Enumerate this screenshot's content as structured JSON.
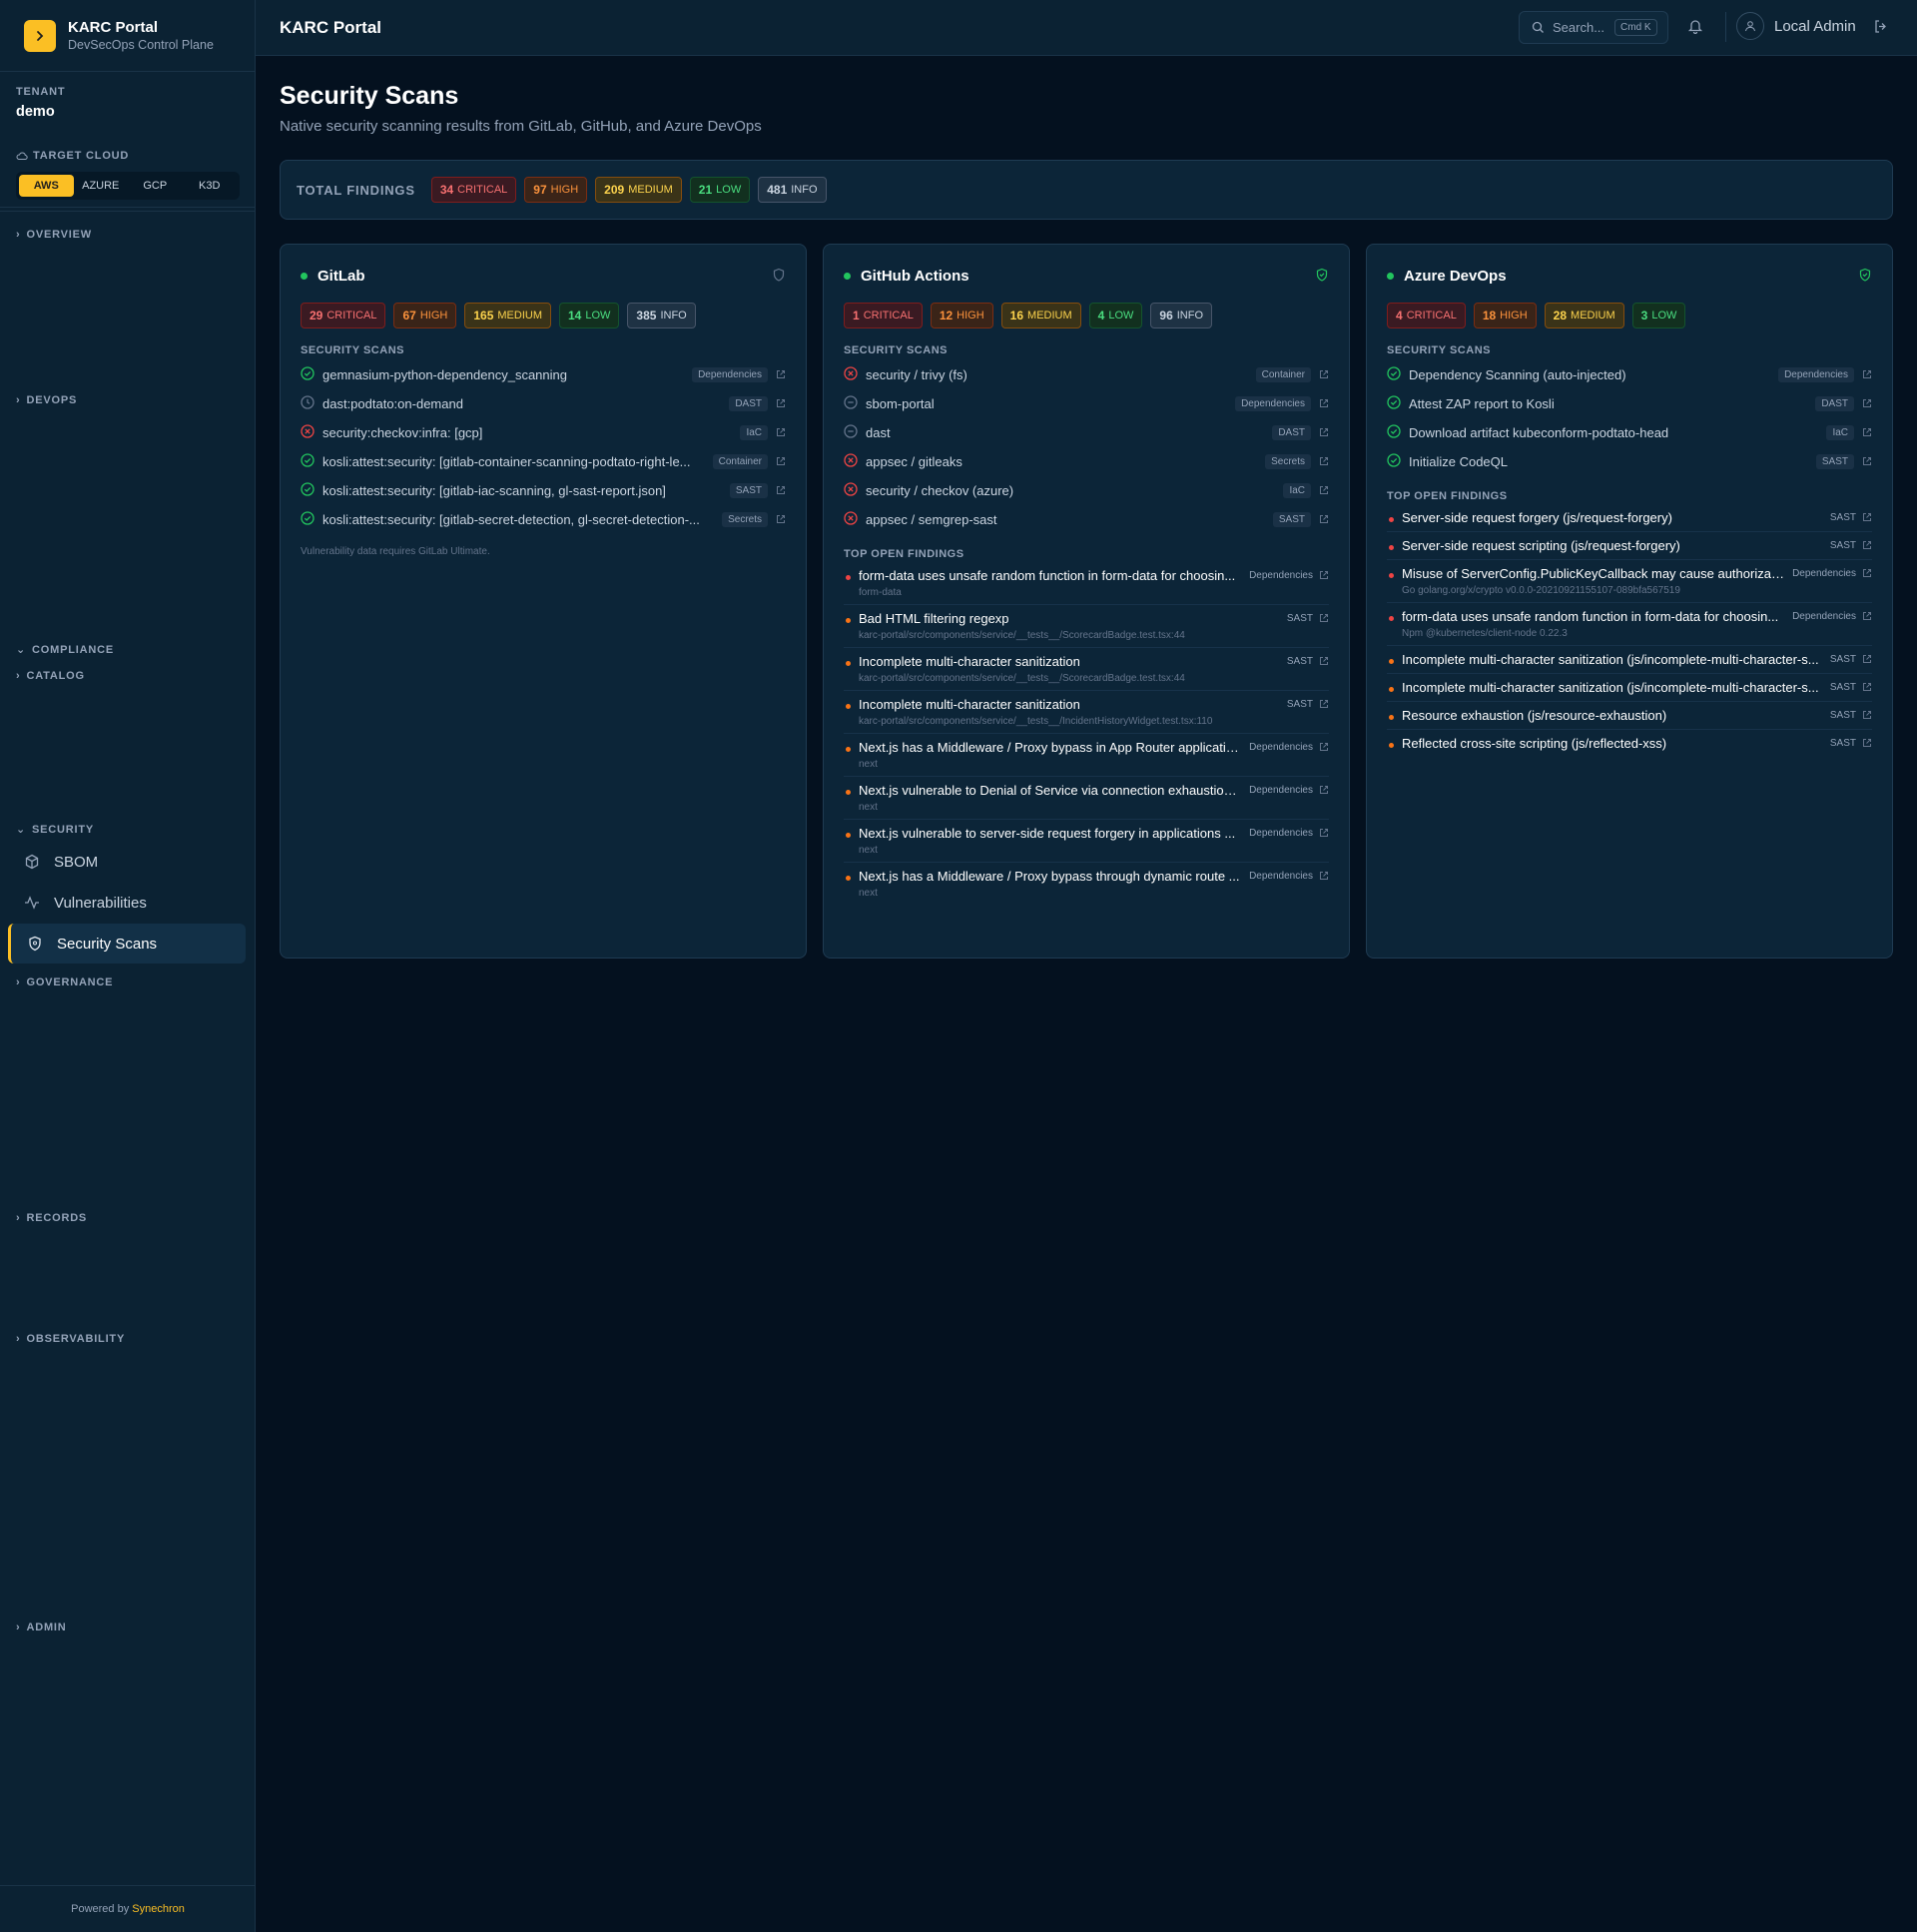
{
  "app": {
    "title": "KARC Portal",
    "subtitle": "DevSecOps Control Plane",
    "powered_prefix": "Powered by",
    "powered_brand": "Synechron"
  },
  "tenant": {
    "label": "TENANT",
    "value": "demo"
  },
  "target_cloud": {
    "label": "TARGET CLOUD",
    "options": [
      "AWS",
      "AZURE",
      "GCP",
      "K3D"
    ],
    "selected": "AWS"
  },
  "nav": {
    "overview": "OVERVIEW",
    "devops": "DEVOPS",
    "compliance": "COMPLIANCE",
    "catalog": "CATALOG",
    "security": "SECURITY",
    "sbom": "SBOM",
    "vulnerabilities": "Vulnerabilities",
    "security_scans": "Security Scans",
    "governance": "GOVERNANCE",
    "records": "RECORDS",
    "observability": "OBSERVABILITY",
    "admin": "ADMIN"
  },
  "header": {
    "title": "KARC Portal",
    "search_placeholder": "Search...",
    "shortcut": "Cmd K",
    "user": "Local Admin"
  },
  "page": {
    "title": "Security Scans",
    "subtitle": "Native security scanning results from GitLab, GitHub, and Azure DevOps",
    "totals_label": "TOTAL FINDINGS",
    "totals": {
      "critical": "34",
      "high": "97",
      "medium": "209",
      "low": "21",
      "info": "481"
    }
  },
  "labels": {
    "critical": "CRITICAL",
    "high": "HIGH",
    "medium": "MEDIUM",
    "low": "LOW",
    "info": "INFO",
    "security_scans": "SECURITY SCANS",
    "top_open_findings": "TOP OPEN FINDINGS"
  },
  "colors": {
    "accent": "#fbbf24",
    "critical": "#ef4444",
    "high": "#f97316",
    "medium": "#facc15",
    "low": "#22c55e",
    "info": "#94a3b8"
  },
  "providers": [
    {
      "name": "GitLab",
      "counts": {
        "critical": "29",
        "high": "67",
        "medium": "165",
        "low": "14",
        "info": "385"
      },
      "scans": [
        {
          "status": "pass",
          "name": "gemnasium-python-dependency_scanning",
          "type": "Dependencies"
        },
        {
          "status": "pending",
          "name": "dast:podtato:on-demand",
          "type": "DAST"
        },
        {
          "status": "fail",
          "name": "security:checkov:infra: [gcp]",
          "type": "IaC"
        },
        {
          "status": "pass",
          "name": "kosli:attest:security: [gitlab-container-scanning-podtato-right-le...",
          "type": "Container"
        },
        {
          "status": "pass",
          "name": "kosli:attest:security: [gitlab-iac-scanning, gl-sast-report.json]",
          "type": "SAST"
        },
        {
          "status": "pass",
          "name": "kosli:attest:security: [gitlab-secret-detection, gl-secret-detection-...",
          "type": "Secrets"
        }
      ],
      "note": "Vulnerability data requires GitLab Ultimate.",
      "findings": []
    },
    {
      "name": "GitHub Actions",
      "counts": {
        "critical": "1",
        "high": "12",
        "medium": "16",
        "low": "4",
        "info": "96"
      },
      "scans": [
        {
          "status": "fail",
          "name": "security / trivy (fs)",
          "type": "Container"
        },
        {
          "status": "skip",
          "name": "sbom-portal",
          "type": "Dependencies"
        },
        {
          "status": "skip",
          "name": "dast",
          "type": "DAST"
        },
        {
          "status": "fail",
          "name": "appsec / gitleaks",
          "type": "Secrets"
        },
        {
          "status": "fail",
          "name": "security / checkov (azure)",
          "type": "IaC"
        },
        {
          "status": "fail",
          "name": "appsec / semgrep-sast",
          "type": "SAST"
        }
      ],
      "note": "",
      "findings": [
        {
          "sev": "critical",
          "name": "form-data uses unsafe random function in form-data for choosin...",
          "pkg": "form-data",
          "type": "Dependencies"
        },
        {
          "sev": "high",
          "name": "Bad HTML filtering regexp",
          "pkg": "karc-portal/src/components/service/__tests__/ScorecardBadge.test.tsx:44",
          "type": "SAST"
        },
        {
          "sev": "high",
          "name": "Incomplete multi-character sanitization",
          "pkg": "karc-portal/src/components/service/__tests__/ScorecardBadge.test.tsx:44",
          "type": "SAST"
        },
        {
          "sev": "high",
          "name": "Incomplete multi-character sanitization",
          "pkg": "karc-portal/src/components/service/__tests__/IncidentHistoryWidget.test.tsx:110",
          "type": "SAST"
        },
        {
          "sev": "high",
          "name": "Next.js has a Middleware / Proxy bypass in App Router applicatio...",
          "pkg": "next",
          "type": "Dependencies"
        },
        {
          "sev": "high",
          "name": "Next.js vulnerable to Denial of Service via connection exhaustion...",
          "pkg": "next",
          "type": "Dependencies"
        },
        {
          "sev": "high",
          "name": "Next.js vulnerable to server-side request forgery in applications ...",
          "pkg": "next",
          "type": "Dependencies"
        },
        {
          "sev": "high",
          "name": "Next.js has a Middleware / Proxy bypass through dynamic route ...",
          "pkg": "next",
          "type": "Dependencies"
        }
      ]
    },
    {
      "name": "Azure DevOps",
      "counts": {
        "critical": "4",
        "high": "18",
        "medium": "28",
        "low": "3"
      },
      "scans": [
        {
          "status": "pass",
          "name": "Dependency Scanning (auto-injected)",
          "type": "Dependencies"
        },
        {
          "status": "pass",
          "name": "Attest ZAP report to Kosli",
          "type": "DAST"
        },
        {
          "status": "pass",
          "name": "Download artifact kubeconform-podtato-head",
          "type": "IaC"
        },
        {
          "status": "pass",
          "name": "Initialize CodeQL",
          "type": "SAST"
        }
      ],
      "note": "",
      "findings": [
        {
          "sev": "critical",
          "name": "Server-side request forgery (js/request-forgery)",
          "pkg": "",
          "type": "SAST"
        },
        {
          "sev": "critical",
          "name": "Server-side request scripting (js/request-forgery)",
          "pkg": "",
          "type": "SAST"
        },
        {
          "sev": "critical",
          "name": "Misuse of ServerConfig.PublicKeyCallback may cause authorizat...",
          "pkg": "Go golang.org/x/crypto v0.0.0-20210921155107-089bfa567519",
          "type": "Dependencies"
        },
        {
          "sev": "critical",
          "name": "form-data uses unsafe random function in form-data for choosin...",
          "pkg": "Npm @kubernetes/client-node 0.22.3",
          "type": "Dependencies"
        },
        {
          "sev": "high",
          "name": "Incomplete multi-character sanitization (js/incomplete-multi-character-s...",
          "pkg": "",
          "type": "SAST"
        },
        {
          "sev": "high",
          "name": "Incomplete multi-character sanitization (js/incomplete-multi-character-s...",
          "pkg": "",
          "type": "SAST"
        },
        {
          "sev": "high",
          "name": "Resource exhaustion (js/resource-exhaustion)",
          "pkg": "",
          "type": "SAST"
        },
        {
          "sev": "high",
          "name": "Reflected cross-site scripting (js/reflected-xss)",
          "pkg": "",
          "type": "SAST"
        }
      ]
    }
  ]
}
